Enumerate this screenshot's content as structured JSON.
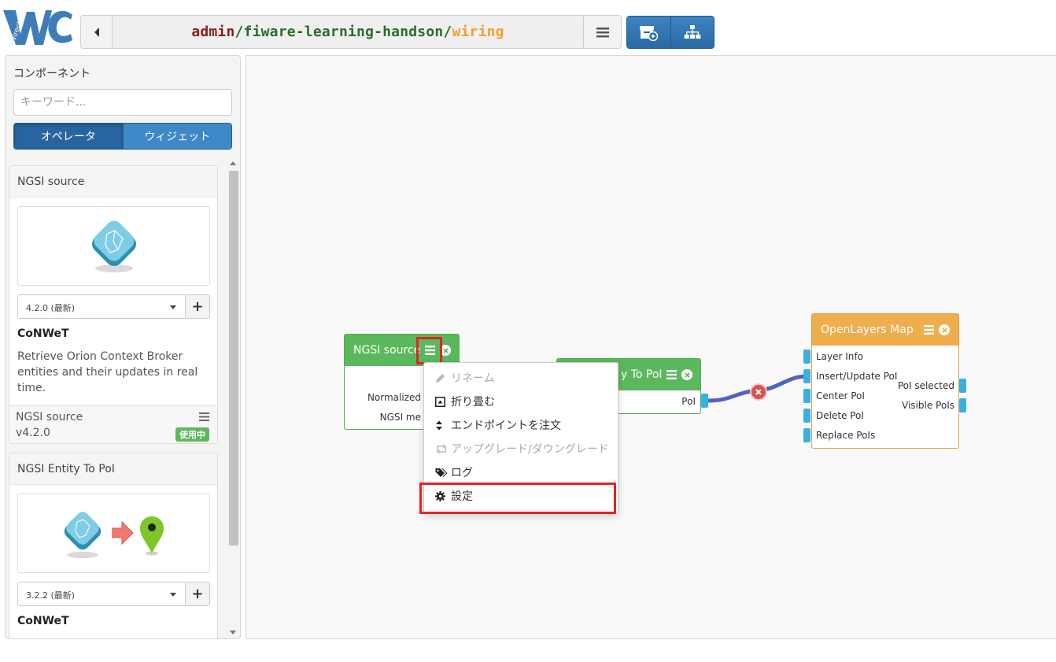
{
  "header": {
    "logo_text": "Wirecloud",
    "path": {
      "owner": "admin",
      "sep1": "/",
      "workspace": "fiware-learning-handson",
      "sep2": "/",
      "view": "wiring"
    }
  },
  "sidebar": {
    "title": "コンポーネント",
    "search_placeholder": "キーワード...",
    "tabs": [
      {
        "label": "オペレータ",
        "active": true
      },
      {
        "label": "ウィジェット",
        "active": false
      }
    ],
    "cards": [
      {
        "title": "NGSI source",
        "version": "4.2.0 (最新)",
        "add_label": "+",
        "vendor": "CoNWeT",
        "description": "Retrieve Orion Context Broker entities and their updates in real time.",
        "footer_name": "NGSI source",
        "footer_version": "v4.2.0",
        "badge": "使用中"
      },
      {
        "title": "NGSI Entity To PoI",
        "version": "3.2.2 (最新)",
        "add_label": "+",
        "vendor": "CoNWeT"
      }
    ]
  },
  "wiring": {
    "components": {
      "ngsi_source": {
        "title": "NGSI source",
        "outputs": [
          "Normalized",
          "NGSI me"
        ]
      },
      "entity_to_poi": {
        "title_visible": "y To PoI",
        "outputs": [
          "PoI"
        ]
      },
      "openlayers_map": {
        "title": "OpenLayers Map",
        "inputs": [
          "Layer Info",
          "Insert/Update PoI",
          "Center PoI",
          "Delete PoI",
          "Replace PoIs"
        ],
        "outputs": [
          "PoI selected",
          "Visible PoIs"
        ]
      }
    },
    "context_menu": [
      {
        "label": "リネーム",
        "icon": "pencil-icon",
        "disabled": true
      },
      {
        "label": "折り畳む",
        "icon": "collapse-icon",
        "disabled": false
      },
      {
        "label": "エンドポイントを注文",
        "icon": "sort-icon",
        "disabled": false
      },
      {
        "label": "アップグレード/ダウングレード",
        "icon": "retweet-icon",
        "disabled": true
      },
      {
        "label": "ログ",
        "icon": "tags-icon",
        "disabled": false
      },
      {
        "label": "設定",
        "icon": "gear-icon",
        "disabled": false
      }
    ]
  },
  "colors": {
    "operator": "#5cb85c",
    "widget": "#f0ad4e",
    "endpoint": "#3ab0e2",
    "connection": "#5062c4",
    "primary": "#2a6aa5",
    "highlight": "#e32424"
  }
}
